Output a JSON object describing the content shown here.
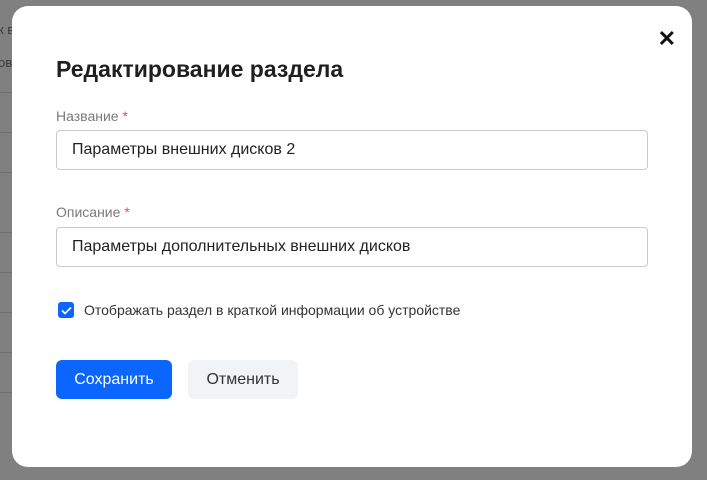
{
  "background": {
    "fragments": [
      "к в",
      "ов"
    ]
  },
  "modal": {
    "title": "Редактирование раздела",
    "close_icon": "close-icon",
    "name_label": "Название",
    "name_value": "Параметры внешних дисков 2",
    "description_label": "Описание",
    "description_value": "Параметры дополнительных внешних дисков",
    "required_mark": "*",
    "show_in_summary_label": "Отображать раздел в краткой информации об устройстве",
    "show_in_summary_checked": true,
    "save_label": "Сохранить",
    "cancel_label": "Отменить",
    "accent_color": "#0a66ff"
  }
}
